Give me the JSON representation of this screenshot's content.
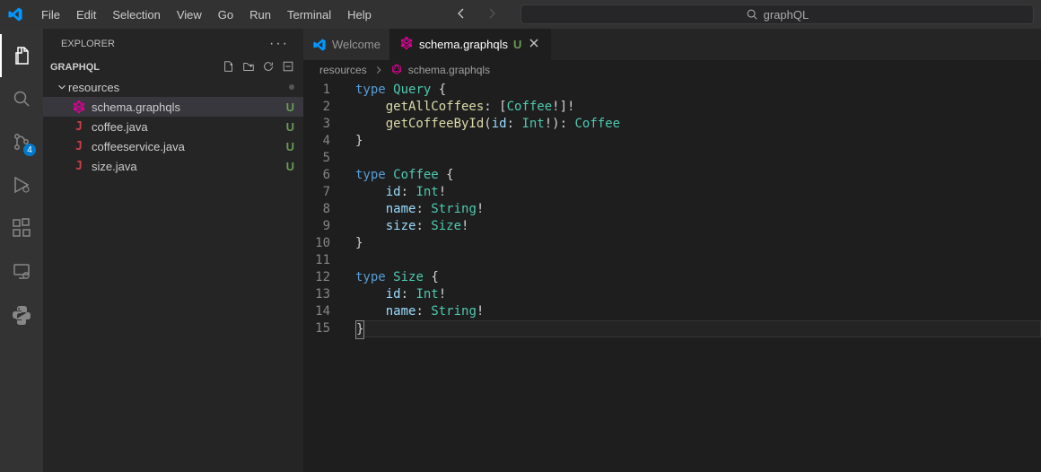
{
  "menu": [
    "File",
    "Edit",
    "Selection",
    "View",
    "Go",
    "Run",
    "Terminal",
    "Help"
  ],
  "search": {
    "value": "graphQL"
  },
  "activity": {
    "scm_badge": "4"
  },
  "sidebar": {
    "title": "EXPLORER",
    "project": "GRAPHQL",
    "folder": {
      "name": "resources"
    },
    "files": [
      {
        "name": "schema.graphqls",
        "status": "U",
        "icon": "graphql"
      },
      {
        "name": "coffee.java",
        "status": "U",
        "icon": "java"
      },
      {
        "name": "coffeeservice.java",
        "status": "U",
        "icon": "java"
      },
      {
        "name": "size.java",
        "status": "U",
        "icon": "java"
      }
    ]
  },
  "tabs": [
    {
      "label": "Welcome",
      "active": false,
      "icon": "vscode"
    },
    {
      "label": "schema.graphqls",
      "modified": "U",
      "active": true,
      "icon": "graphql",
      "git": "untracked"
    }
  ],
  "breadcrumb": {
    "parts": [
      "resources",
      "schema.graphqls"
    ]
  },
  "code": {
    "lines": 15,
    "content": [
      "type Query {",
      "    getAllCoffees: [Coffee!]!",
      "    getCoffeeById(id: Int!): Coffee",
      "}",
      "",
      "type Coffee {",
      "    id: Int!",
      "    name: String!",
      "    size: Size!",
      "}",
      "",
      "type Size {",
      "    id: Int!",
      "    name: String!",
      "}"
    ],
    "tokens": [
      [
        [
          "kw",
          "type "
        ],
        [
          "typ",
          "Query "
        ],
        [
          "punct",
          "{"
        ]
      ],
      [
        [
          "punct",
          "    "
        ],
        [
          "mth",
          "getAllCoffees"
        ],
        [
          "op",
          ": ["
        ],
        [
          "typ",
          "Coffee"
        ],
        [
          "op",
          "!]!"
        ]
      ],
      [
        [
          "punct",
          "    "
        ],
        [
          "mth",
          "getCoffeeById"
        ],
        [
          "op",
          "("
        ],
        [
          "var",
          "id"
        ],
        [
          "op",
          ": "
        ],
        [
          "typ",
          "Int"
        ],
        [
          "op",
          "!): "
        ],
        [
          "typ",
          "Coffee"
        ]
      ],
      [
        [
          "punct",
          "}"
        ]
      ],
      [],
      [
        [
          "kw",
          "type "
        ],
        [
          "typ",
          "Coffee "
        ],
        [
          "punct",
          "{"
        ]
      ],
      [
        [
          "punct",
          "    "
        ],
        [
          "var",
          "id"
        ],
        [
          "op",
          ": "
        ],
        [
          "typ",
          "Int"
        ],
        [
          "op",
          "!"
        ]
      ],
      [
        [
          "punct",
          "    "
        ],
        [
          "var",
          "name"
        ],
        [
          "op",
          ": "
        ],
        [
          "typ",
          "String"
        ],
        [
          "op",
          "!"
        ]
      ],
      [
        [
          "punct",
          "    "
        ],
        [
          "var",
          "size"
        ],
        [
          "op",
          ": "
        ],
        [
          "typ",
          "Size"
        ],
        [
          "op",
          "!"
        ]
      ],
      [
        [
          "punct",
          "}"
        ]
      ],
      [],
      [
        [
          "kw",
          "type "
        ],
        [
          "typ",
          "Size "
        ],
        [
          "punct",
          "{"
        ]
      ],
      [
        [
          "punct",
          "    "
        ],
        [
          "var",
          "id"
        ],
        [
          "op",
          ": "
        ],
        [
          "typ",
          "Int"
        ],
        [
          "op",
          "!"
        ]
      ],
      [
        [
          "punct",
          "    "
        ],
        [
          "var",
          "name"
        ],
        [
          "op",
          ": "
        ],
        [
          "typ",
          "String"
        ],
        [
          "op",
          "!"
        ]
      ],
      [
        [
          "punct",
          "}"
        ]
      ]
    ],
    "current_line": 15
  },
  "colors": {
    "graphql": "#e10098",
    "java": "#cc3e44",
    "vscode": "#0065a9",
    "active_border": "#ffffff"
  }
}
